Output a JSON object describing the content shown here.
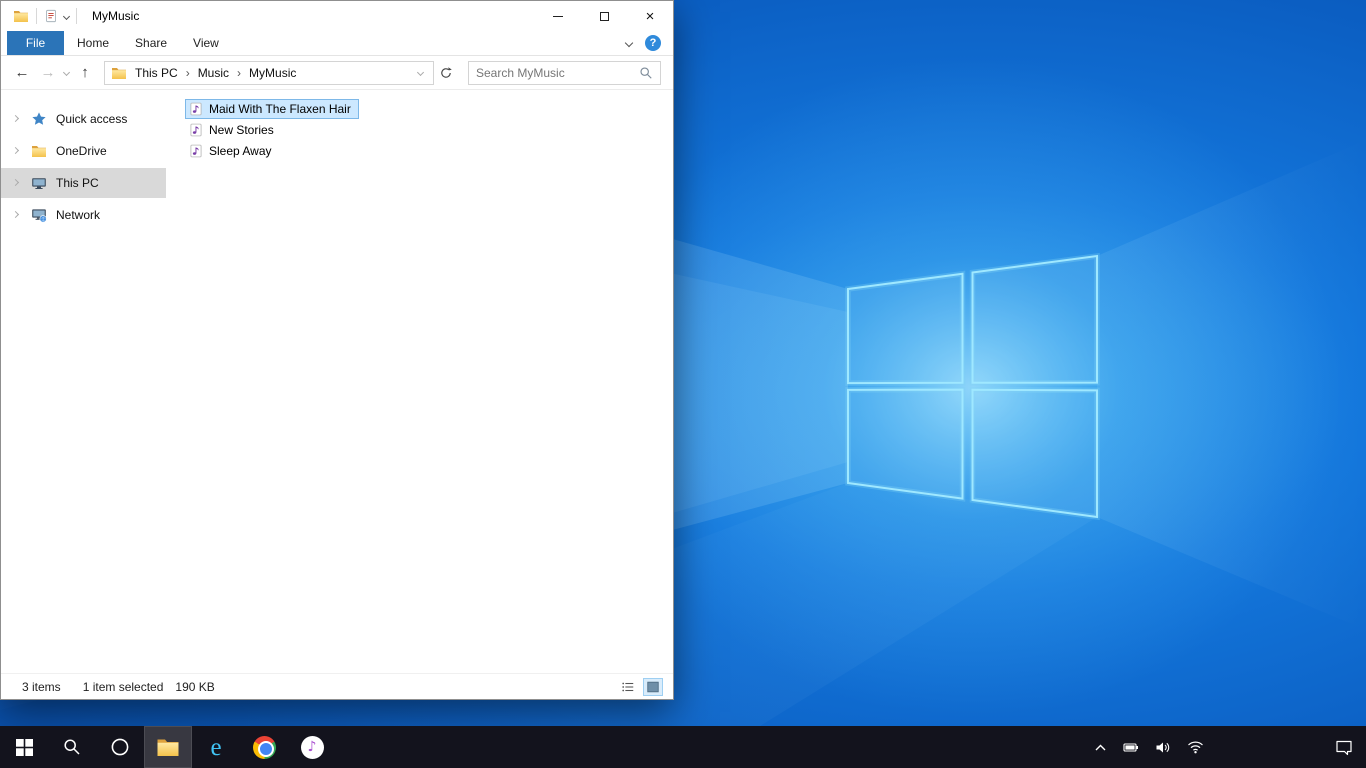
{
  "explorer": {
    "title": "MyMusic",
    "ribbon": {
      "file_tab": "File",
      "tabs": [
        "Home",
        "Share",
        "View"
      ]
    },
    "toolbar": {
      "breadcrumb": [
        "This PC",
        "Music",
        "MyMusic"
      ],
      "search_placeholder": "Search MyMusic"
    },
    "nav_items": [
      {
        "label": "Quick access",
        "icon": "star-icon"
      },
      {
        "label": "OneDrive",
        "icon": "folder-icon"
      },
      {
        "label": "This PC",
        "icon": "pc-icon",
        "selected": true
      },
      {
        "label": "Network",
        "icon": "network-icon"
      }
    ],
    "files": [
      {
        "name": "Maid With The Flaxen Hair",
        "icon": "audio-file-icon",
        "selected": true
      },
      {
        "name": "New Stories",
        "icon": "audio-file-icon"
      },
      {
        "name": "Sleep Away",
        "icon": "audio-file-icon"
      }
    ],
    "status": {
      "item_count": "3 items",
      "selection": "1 item selected",
      "selection_size": "190 KB"
    }
  },
  "glyphs": {
    "back_arrow": "←",
    "forward_arrow": "→",
    "up_arrow": "↑",
    "breadcrumb_separator": "›",
    "help": "?",
    "close": "×",
    "music_note": "♪",
    "ie_letter": "e"
  },
  "colors": {
    "file_tab_blue": "#2b74b8",
    "selected_file_bg": "#cce8ff",
    "selected_file_border": "#7db8e8",
    "nav_selected_bg": "#d9d9d9",
    "taskbar_bg": "#13131d",
    "wallpaper_base": "#0d63c6",
    "logo_cyan": "#9fe8ff"
  },
  "taskbar_items": [
    "start",
    "search",
    "cortana",
    "file-explorer",
    "internet-explorer",
    "chrome",
    "itunes"
  ],
  "tray_items": [
    "show-hidden-icons",
    "battery",
    "volume",
    "network",
    "action-center"
  ]
}
